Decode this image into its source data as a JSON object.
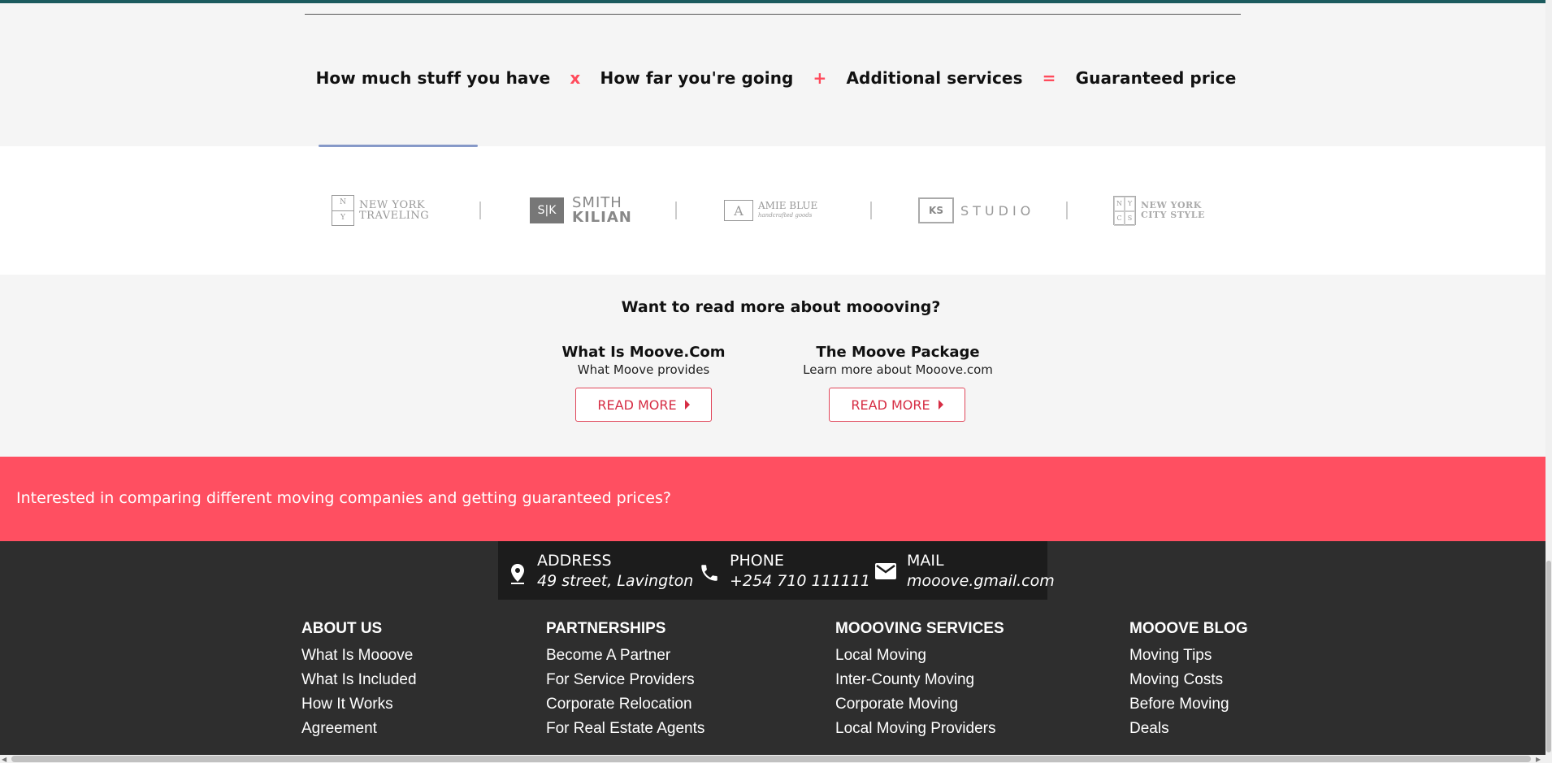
{
  "formula": {
    "term1": "How much stuff you have",
    "op1": "x",
    "term2": "How far you're going",
    "op2": "+",
    "term3": "Additional services",
    "op3": "=",
    "term4": "Guaranteed price"
  },
  "logos": [
    {
      "name": "NEW YORK TRAVELING",
      "line1": "NEW YORK",
      "line2": "TRAVELING",
      "mark": "N Y"
    },
    {
      "name": "SMITH KILIAN",
      "line1": "SMITH",
      "line2": "KILIAN",
      "mark": "S|K"
    },
    {
      "name": "AMIE BLUE",
      "line1": "AMIE BLUE",
      "line2": "handcrafted goods",
      "mark": "A"
    },
    {
      "name": "KS STUDIO",
      "line1": "STUDIO",
      "mark": "KS"
    },
    {
      "name": "NEW YORK CITY STYLE",
      "line1": "NEW YORK",
      "line2": "CITY STYLE",
      "mark": "NYCS"
    }
  ],
  "read_more": {
    "title": "Want to read more about moooving?",
    "cards": [
      {
        "title": "What Is Moove.Com",
        "subtitle": "What Moove provides",
        "button": "READ MORE"
      },
      {
        "title": "The Moove Package",
        "subtitle": "Learn more about Mooove.com",
        "button": "READ MORE"
      }
    ]
  },
  "promo": {
    "text": "Interested in comparing different moving companies and getting guaranteed prices?"
  },
  "contact": {
    "address_label": "ADDRESS",
    "address_value": "49 street, Lavington",
    "phone_label": "PHONE",
    "phone_value": "+254 710 111111",
    "mail_label": "MAIL",
    "mail_value": "mooove.gmail.com"
  },
  "footer": {
    "columns": [
      {
        "heading": "ABOUT US",
        "links": [
          "What Is Mooove",
          "What Is Included",
          "How It Works",
          "Agreement"
        ]
      },
      {
        "heading": "PARTNERSHIPS",
        "links": [
          "Become A Partner",
          "For Service Providers",
          "Corporate Relocation",
          "For Real Estate Agents"
        ]
      },
      {
        "heading": "MOOOVING SERVICES",
        "links": [
          "Local Moving",
          "Inter-County Moving",
          "Corporate Moving",
          "Local Moving Providers"
        ]
      },
      {
        "heading": "MOOOVE BLOG",
        "links": [
          "Moving Tips",
          "Moving Costs",
          "Before Moving",
          "Deals"
        ]
      }
    ]
  },
  "colors": {
    "accent": "#ff4f61",
    "footer_bg": "#2e2e2e",
    "contact_bar_bg": "#1c1c1c",
    "button_text": "#d62d44"
  },
  "icons": {
    "address": "location-pin-icon",
    "phone": "phone-icon",
    "mail": "mail-icon",
    "read_more_arrow": "caret-right-icon"
  }
}
